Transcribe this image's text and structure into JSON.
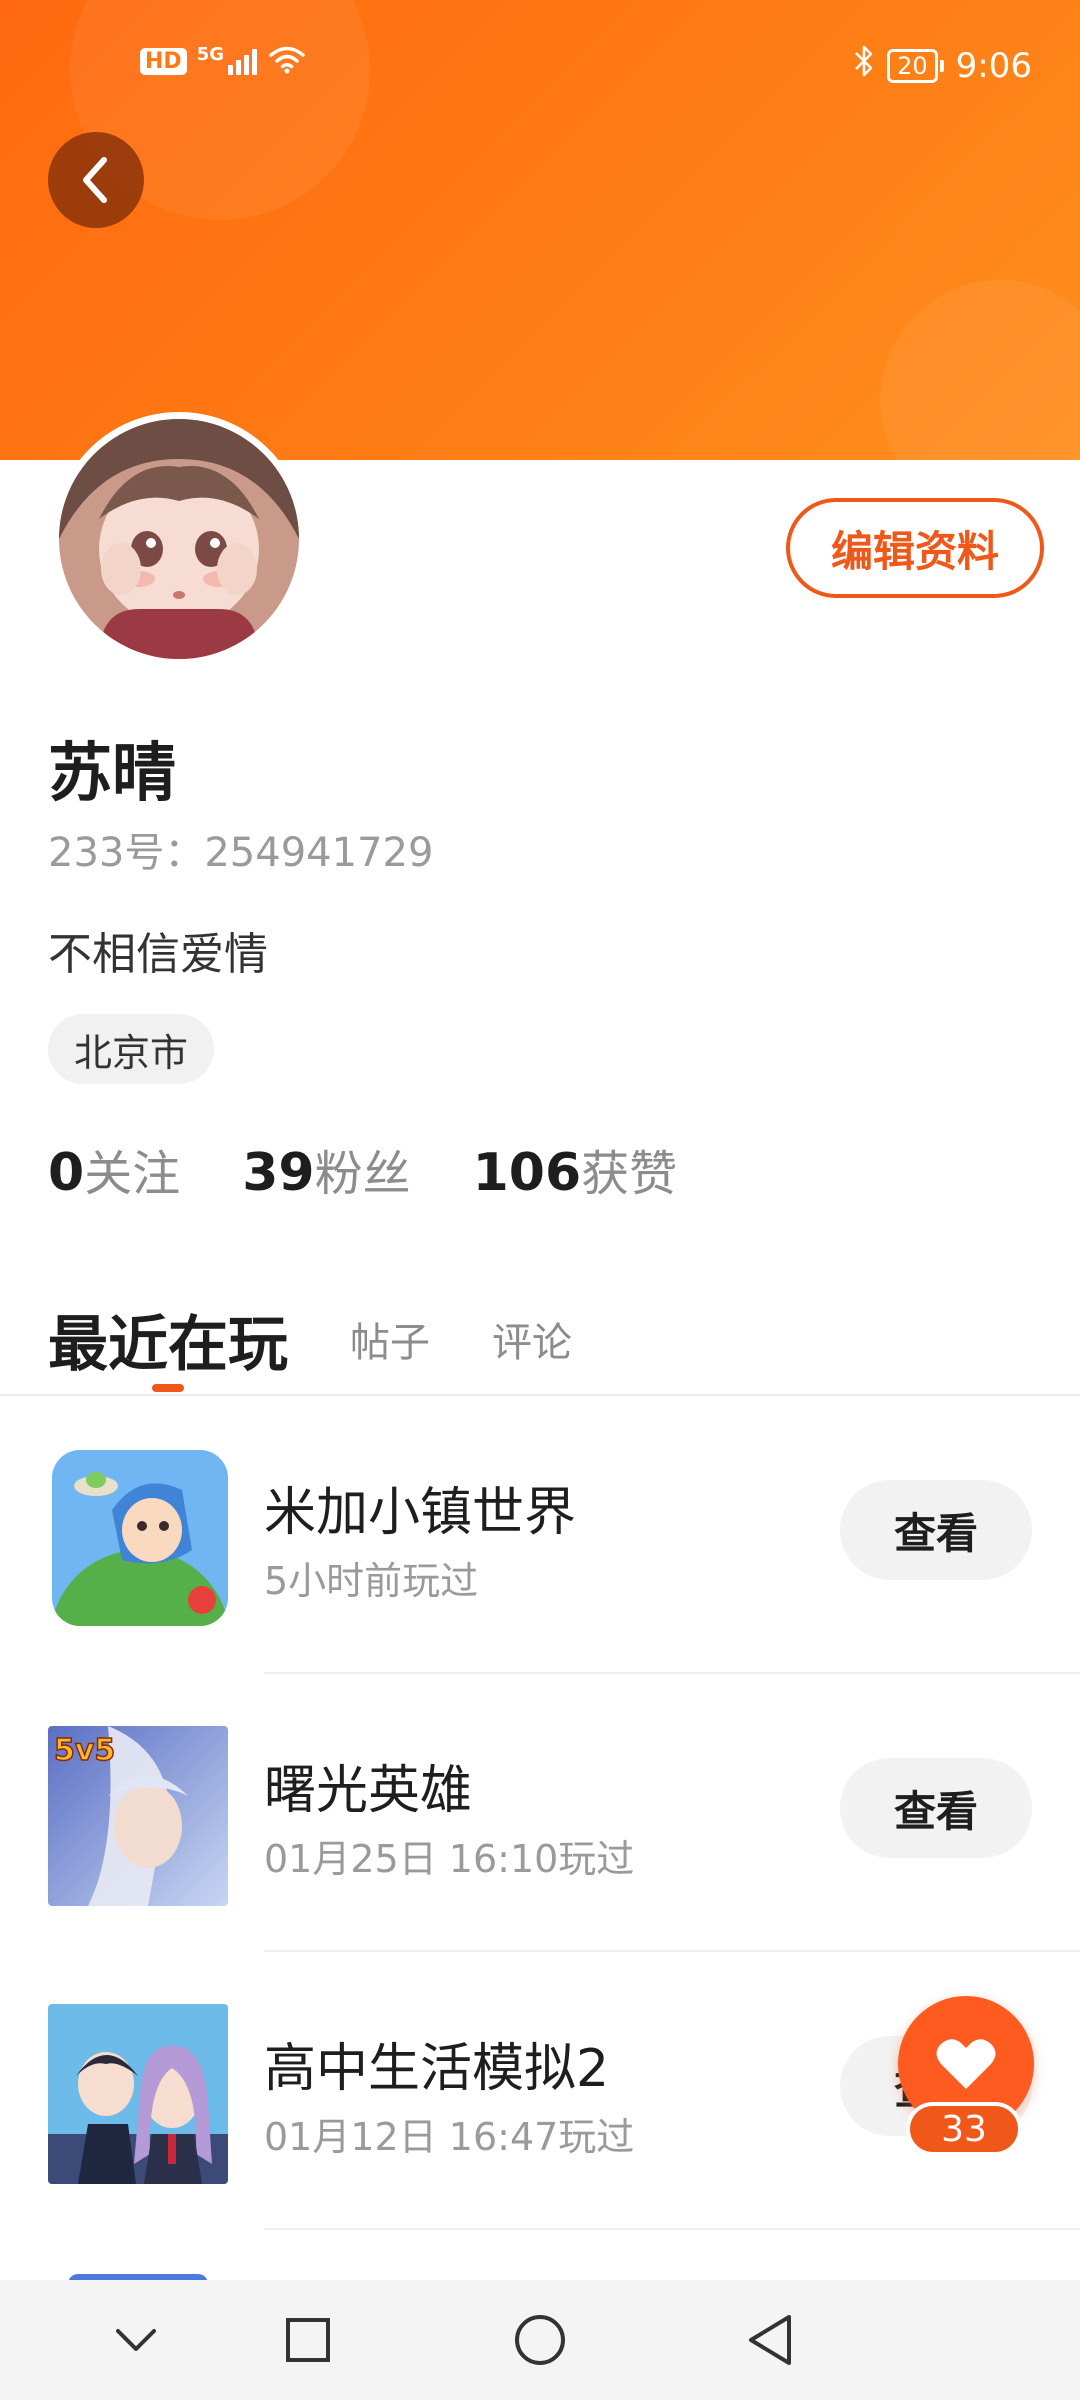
{
  "status_bar": {
    "hd": "HD",
    "network": "5G",
    "battery": "20",
    "time": "9:06"
  },
  "profile": {
    "name": "苏晴",
    "uid": "233号：254941729",
    "bio": "不相信爱情",
    "location": "北京市",
    "edit_label": "编辑资料",
    "stats": [
      {
        "num": "0",
        "label": "关注"
      },
      {
        "num": "39",
        "label": "粉丝"
      },
      {
        "num": "106",
        "label": "获赞"
      }
    ]
  },
  "tabs": [
    {
      "label": "最近在玩",
      "active": true
    },
    {
      "label": "帖子",
      "active": false
    },
    {
      "label": "评论",
      "active": false
    }
  ],
  "games": [
    {
      "title": "米加小镇世界",
      "time": "5小时前玩过",
      "button": "查看",
      "icon": "toca-world-icon"
    },
    {
      "title": "曙光英雄",
      "time": "01月25日 16:10玩过",
      "button": "查看",
      "icon": "dawn-heroes-icon",
      "badge": "5v5"
    },
    {
      "title": "高中生活模拟2",
      "time": "01月12日 16:47玩过",
      "button": "查看",
      "icon": "high-school-sim-icon"
    }
  ],
  "like_fab": {
    "count": "33",
    "icon": "heart-icon"
  },
  "colors": {
    "accent": "#f0581a",
    "banner": "#ff7a14"
  }
}
